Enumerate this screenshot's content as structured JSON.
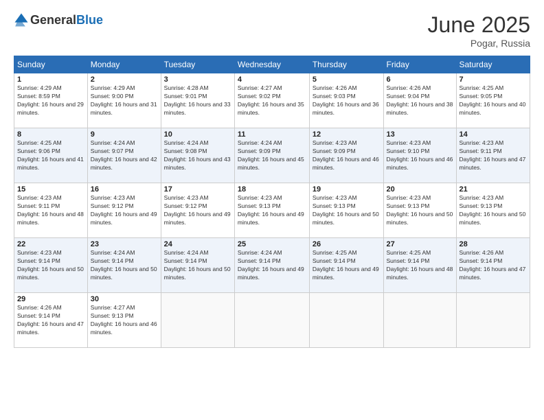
{
  "header": {
    "logo_general": "General",
    "logo_blue": "Blue",
    "title": "June 2025",
    "location": "Pogar, Russia"
  },
  "weekdays": [
    "Sunday",
    "Monday",
    "Tuesday",
    "Wednesday",
    "Thursday",
    "Friday",
    "Saturday"
  ],
  "weeks": [
    [
      {
        "day": "1",
        "sunrise": "4:29 AM",
        "sunset": "8:59 PM",
        "daylight": "16 hours and 29 minutes."
      },
      {
        "day": "2",
        "sunrise": "4:29 AM",
        "sunset": "9:00 PM",
        "daylight": "16 hours and 31 minutes."
      },
      {
        "day": "3",
        "sunrise": "4:28 AM",
        "sunset": "9:01 PM",
        "daylight": "16 hours and 33 minutes."
      },
      {
        "day": "4",
        "sunrise": "4:27 AM",
        "sunset": "9:02 PM",
        "daylight": "16 hours and 35 minutes."
      },
      {
        "day": "5",
        "sunrise": "4:26 AM",
        "sunset": "9:03 PM",
        "daylight": "16 hours and 36 minutes."
      },
      {
        "day": "6",
        "sunrise": "4:26 AM",
        "sunset": "9:04 PM",
        "daylight": "16 hours and 38 minutes."
      },
      {
        "day": "7",
        "sunrise": "4:25 AM",
        "sunset": "9:05 PM",
        "daylight": "16 hours and 40 minutes."
      }
    ],
    [
      {
        "day": "8",
        "sunrise": "4:25 AM",
        "sunset": "9:06 PM",
        "daylight": "16 hours and 41 minutes."
      },
      {
        "day": "9",
        "sunrise": "4:24 AM",
        "sunset": "9:07 PM",
        "daylight": "16 hours and 42 minutes."
      },
      {
        "day": "10",
        "sunrise": "4:24 AM",
        "sunset": "9:08 PM",
        "daylight": "16 hours and 43 minutes."
      },
      {
        "day": "11",
        "sunrise": "4:24 AM",
        "sunset": "9:09 PM",
        "daylight": "16 hours and 45 minutes."
      },
      {
        "day": "12",
        "sunrise": "4:23 AM",
        "sunset": "9:09 PM",
        "daylight": "16 hours and 46 minutes."
      },
      {
        "day": "13",
        "sunrise": "4:23 AM",
        "sunset": "9:10 PM",
        "daylight": "16 hours and 46 minutes."
      },
      {
        "day": "14",
        "sunrise": "4:23 AM",
        "sunset": "9:11 PM",
        "daylight": "16 hours and 47 minutes."
      }
    ],
    [
      {
        "day": "15",
        "sunrise": "4:23 AM",
        "sunset": "9:11 PM",
        "daylight": "16 hours and 48 minutes."
      },
      {
        "day": "16",
        "sunrise": "4:23 AM",
        "sunset": "9:12 PM",
        "daylight": "16 hours and 49 minutes."
      },
      {
        "day": "17",
        "sunrise": "4:23 AM",
        "sunset": "9:12 PM",
        "daylight": "16 hours and 49 minutes."
      },
      {
        "day": "18",
        "sunrise": "4:23 AM",
        "sunset": "9:13 PM",
        "daylight": "16 hours and 49 minutes."
      },
      {
        "day": "19",
        "sunrise": "4:23 AM",
        "sunset": "9:13 PM",
        "daylight": "16 hours and 50 minutes."
      },
      {
        "day": "20",
        "sunrise": "4:23 AM",
        "sunset": "9:13 PM",
        "daylight": "16 hours and 50 minutes."
      },
      {
        "day": "21",
        "sunrise": "4:23 AM",
        "sunset": "9:13 PM",
        "daylight": "16 hours and 50 minutes."
      }
    ],
    [
      {
        "day": "22",
        "sunrise": "4:23 AM",
        "sunset": "9:14 PM",
        "daylight": "16 hours and 50 minutes."
      },
      {
        "day": "23",
        "sunrise": "4:24 AM",
        "sunset": "9:14 PM",
        "daylight": "16 hours and 50 minutes."
      },
      {
        "day": "24",
        "sunrise": "4:24 AM",
        "sunset": "9:14 PM",
        "daylight": "16 hours and 50 minutes."
      },
      {
        "day": "25",
        "sunrise": "4:24 AM",
        "sunset": "9:14 PM",
        "daylight": "16 hours and 49 minutes."
      },
      {
        "day": "26",
        "sunrise": "4:25 AM",
        "sunset": "9:14 PM",
        "daylight": "16 hours and 49 minutes."
      },
      {
        "day": "27",
        "sunrise": "4:25 AM",
        "sunset": "9:14 PM",
        "daylight": "16 hours and 48 minutes."
      },
      {
        "day": "28",
        "sunrise": "4:26 AM",
        "sunset": "9:14 PM",
        "daylight": "16 hours and 47 minutes."
      }
    ],
    [
      {
        "day": "29",
        "sunrise": "4:26 AM",
        "sunset": "9:14 PM",
        "daylight": "16 hours and 47 minutes."
      },
      {
        "day": "30",
        "sunrise": "4:27 AM",
        "sunset": "9:13 PM",
        "daylight": "16 hours and 46 minutes."
      },
      null,
      null,
      null,
      null,
      null
    ]
  ]
}
